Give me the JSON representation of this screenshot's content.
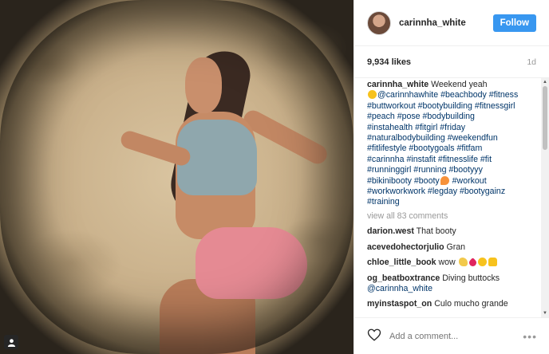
{
  "post": {
    "username": "carinnha_white",
    "follow_label": "Follow",
    "likes": "9,934 likes",
    "age": "1d"
  },
  "caption": {
    "username": "carinnha_white",
    "text_before": "Weekend yeah",
    "line1": "@carinnhawhite #beachbody #fitness",
    "line2": "#buttworkout #bootybuilding #fitnessgirl",
    "line3": "#peach #pose #bodybuilding",
    "line4": "#instahealth #fitgirl #friday",
    "line5": "#naturalbodybuilding #weekendfun",
    "line6": "#fitlifestyle #bootygoals #fitfam",
    "line7": "#carinnha #instafit #fitnesslife #fit",
    "line8": "#runninggirl #running #bootyyy",
    "line9a": "#bikinibooty #booty",
    "line9b": "#workout",
    "line10": "#workworkwork #legday #bootygainz",
    "line11": "#training"
  },
  "view_all": "view all 83 comments",
  "comments": [
    {
      "user": "darion.west",
      "text": "That booty"
    },
    {
      "user": "acevedohectorjulio",
      "text": "Gran"
    },
    {
      "user": "chloe_little_book",
      "text": "wow"
    },
    {
      "user": "og_beatboxtrance",
      "text": "Diving buttocks",
      "mention": "@carinnha_white"
    },
    {
      "user": "myinstaspot_on",
      "text": "Culo mucho grande"
    }
  ],
  "add_comment": {
    "placeholder": "Add a comment...",
    "more": "•••"
  },
  "icons": {
    "user_tag": "user-silhouette-icon",
    "like": "heart-outline-icon",
    "options": "ellipsis-icon"
  },
  "colors": {
    "follow_button": "#3897f0",
    "hashtag": "#003569",
    "muted": "#999999"
  }
}
